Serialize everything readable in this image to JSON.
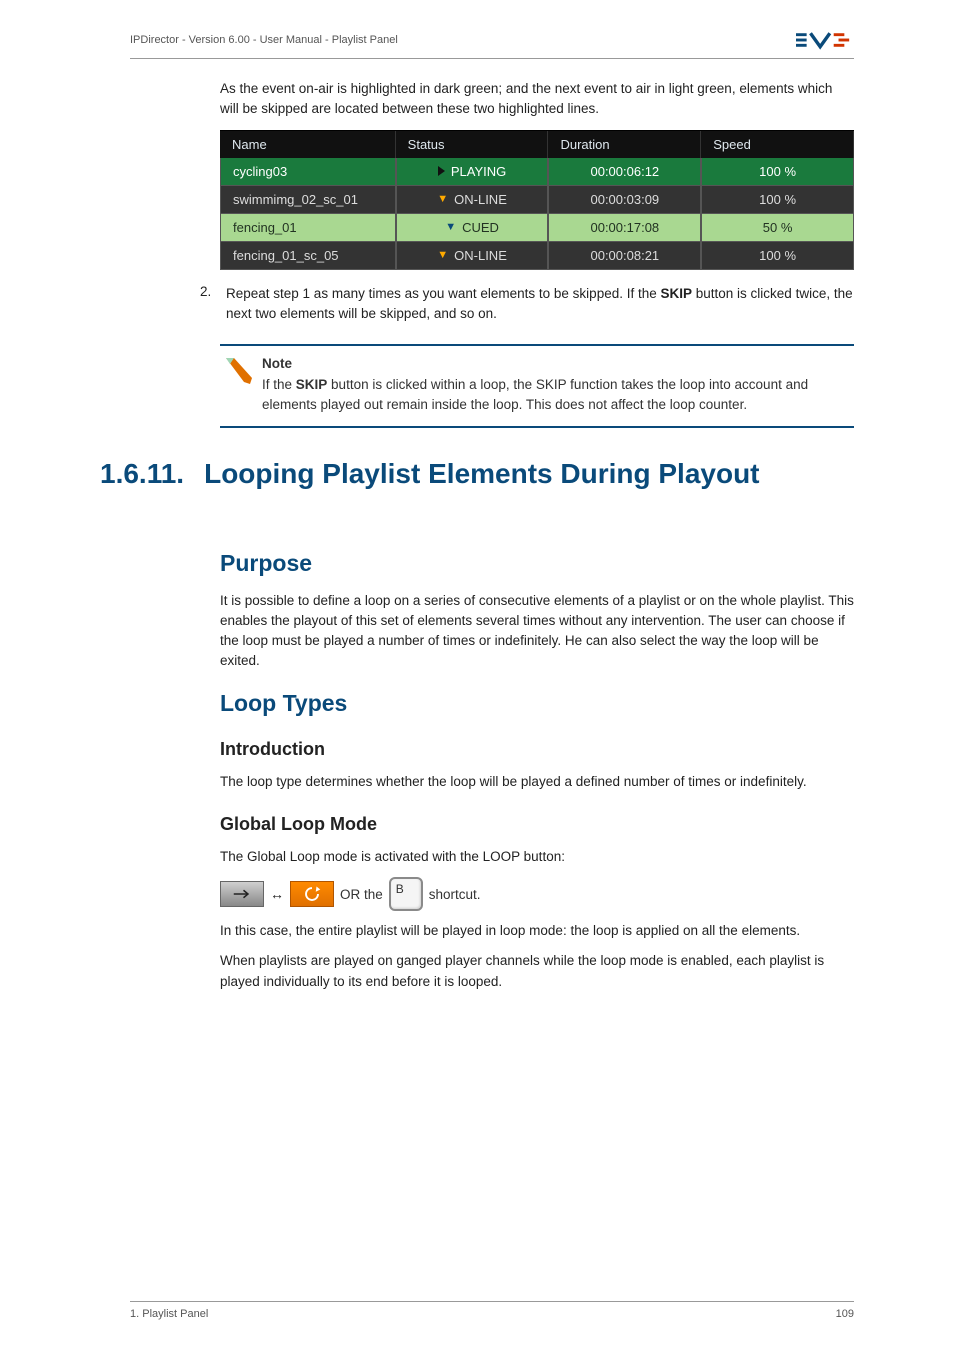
{
  "header": {
    "breadcrumb": "IPDirector - Version 6.00 - User Manual - Playlist Panel"
  },
  "intro_text": "As the event on-air is highlighted in dark green; and the next event to air in light green, elements which will be skipped are located between these two highlighted lines.",
  "table": {
    "headers": {
      "name": "Name",
      "status": "Status",
      "duration": "Duration",
      "speed": "Speed"
    },
    "rows": [
      {
        "name": "cycling03",
        "status": "PLAYING",
        "duration": "00:00:06:12",
        "speed": "100 %"
      },
      {
        "name": "swimmimg_02_sc_01",
        "status": "ON-LINE",
        "duration": "00:00:03:09",
        "speed": "100 %"
      },
      {
        "name": "fencing_01",
        "status": "CUED",
        "duration": "00:00:17:08",
        "speed": "50 %"
      },
      {
        "name": "fencing_01_sc_05",
        "status": "ON-LINE",
        "duration": "00:00:08:21",
        "speed": "100 %"
      }
    ]
  },
  "step2": {
    "num": "2.",
    "prefix": "Repeat step 1 as many times as you want elements to be skipped. If the ",
    "bold": "SKIP",
    "suffix": " button is clicked twice, the next two elements will be skipped, and so on."
  },
  "note": {
    "label": "Note",
    "prefix": "If the ",
    "bold": "SKIP",
    "suffix": " button is clicked within a loop, the SKIP function takes the loop into account and elements played out remain inside the loop. This does not affect the loop counter."
  },
  "section": {
    "num": "1.6.11.",
    "title": "Looping Playlist Elements During Playout"
  },
  "purpose": {
    "heading": "Purpose",
    "text": "It is possible to define a loop on a series of consecutive elements of a playlist or on the whole playlist. This enables the playout of this set of elements several times without any intervention. The user can choose if the loop must be played a number of times or indefinitely. He can also select the way the loop will be exited."
  },
  "loop_types": {
    "heading": "Loop Types",
    "intro_heading": "Introduction",
    "intro_text": "The loop type determines whether the loop will be played a defined number of times or indefinitely.",
    "global_heading": "Global Loop Mode",
    "global_line1": "The Global Loop mode is activated with the LOOP button:",
    "or_the": " OR the ",
    "shortcut_suffix": " shortcut.",
    "key_label": "B",
    "global_line2": "In this case, the entire playlist will be played in loop mode: the loop is applied on all the elements.",
    "global_line3": "When playlists are played on ganged player channels while the loop mode is enabled, each playlist is played individually to its end before it is looped."
  },
  "footer": {
    "left": "1. Playlist Panel",
    "right": "109"
  }
}
